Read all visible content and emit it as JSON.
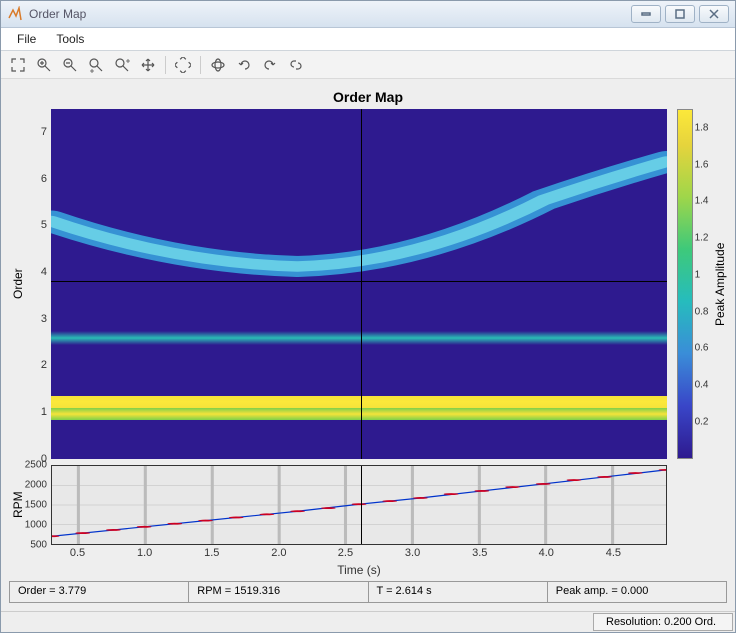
{
  "window": {
    "title": "Order Map"
  },
  "menu": {
    "file": "File",
    "tools": "Tools"
  },
  "toolbar": {
    "icons": [
      "expand",
      "zoom-in",
      "zoom-out",
      "zoom-x",
      "zoom-y",
      "pan",
      "pick",
      "rotate3d",
      "undo",
      "redo",
      "link"
    ]
  },
  "chart": {
    "title": "Order Map",
    "ylabel": "Order",
    "xlabel": "Time (s)",
    "cbar_label": "Peak Amplitude",
    "xlim": [
      0.3,
      4.9
    ],
    "ylim": [
      0,
      7.5
    ],
    "yticks": [
      0,
      1,
      2,
      3,
      4,
      5,
      6,
      7
    ],
    "xticks": [
      0.5,
      1.0,
      1.5,
      2.0,
      2.5,
      3.0,
      3.5,
      4.0,
      4.5
    ],
    "cbar_ticks": [
      0.2,
      0.4,
      0.6,
      0.8,
      1,
      1.2,
      1.4,
      1.6,
      1.8
    ],
    "cursor": {
      "order": 3.779,
      "time": 2.614
    }
  },
  "rpm": {
    "ylabel": "RPM",
    "ylim": [
      500,
      2500
    ],
    "yticks": [
      500,
      1000,
      1500,
      2000,
      2500
    ]
  },
  "status": {
    "order": "Order = 3.779",
    "rpm": "RPM = 1519.316",
    "t": "T = 2.614 s",
    "peak": "Peak amp. = 0.000"
  },
  "footer": {
    "resolution": "Resolution: 0.200 Ord."
  },
  "chart_data": {
    "type": "heatmap",
    "title": "Order Map",
    "xlabel": "Time (s)",
    "ylabel": "Order",
    "clabel": "Peak Amplitude",
    "xlim": [
      0.3,
      4.9
    ],
    "ylim": [
      0,
      7.5
    ],
    "clim": [
      0,
      1.9
    ],
    "order_bands": [
      {
        "order": 0.9,
        "amplitude": 1.6,
        "note": "constant bright yellow band"
      },
      {
        "order": 1.15,
        "amplitude": 1.85,
        "note": "brightest yellow band"
      },
      {
        "order": 2.55,
        "amplitude": 0.9,
        "note": "constant teal band"
      }
    ],
    "sweep_curve": {
      "note": "broad cyan ridge, amplitude ~0.5",
      "points": [
        {
          "t": 0.3,
          "order": 5.1
        },
        {
          "t": 0.8,
          "order": 4.5
        },
        {
          "t": 1.5,
          "order": 4.2
        },
        {
          "t": 2.1,
          "order": 4.1
        },
        {
          "t": 2.6,
          "order": 4.25
        },
        {
          "t": 3.2,
          "order": 4.7
        },
        {
          "t": 3.8,
          "order": 5.2
        },
        {
          "t": 4.4,
          "order": 5.8
        },
        {
          "t": 4.9,
          "order": 6.2
        }
      ]
    },
    "rpm_timeseries": {
      "type": "line",
      "xlabel": "Time (s)",
      "ylabel": "RPM",
      "xlim": [
        0.3,
        4.9
      ],
      "ylim": [
        500,
        2500
      ],
      "points": [
        {
          "t": 0.3,
          "rpm": 700
        },
        {
          "t": 1.0,
          "rpm": 950
        },
        {
          "t": 1.5,
          "rpm": 1120
        },
        {
          "t": 2.0,
          "rpm": 1300
        },
        {
          "t": 2.5,
          "rpm": 1480
        },
        {
          "t": 2.614,
          "rpm": 1519.316
        },
        {
          "t": 3.0,
          "rpm": 1660
        },
        {
          "t": 3.5,
          "rpm": 1850
        },
        {
          "t": 4.0,
          "rpm": 2040
        },
        {
          "t": 4.5,
          "rpm": 2230
        },
        {
          "t": 4.9,
          "rpm": 2400
        }
      ]
    },
    "crosshair": {
      "t": 2.614,
      "order": 3.779,
      "rpm": 1519.316,
      "peak_amp": 0.0
    }
  }
}
